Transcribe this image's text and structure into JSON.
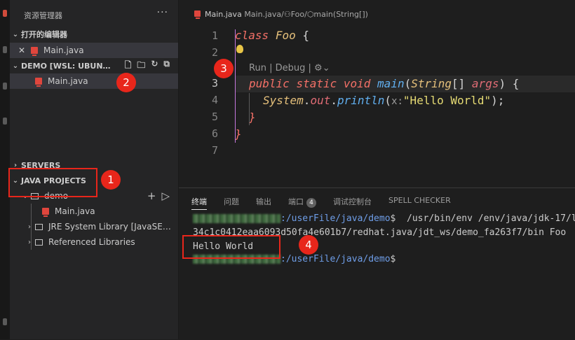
{
  "sidebar": {
    "title": "资源管理器",
    "more": "···",
    "open_editors": {
      "label": "打开的编辑器",
      "file": "Main.java",
      "close": "✕"
    },
    "workspace": {
      "label": "DEMO [WSL: UBUN…",
      "file": "Main.java"
    },
    "servers": {
      "label": "SERVERS"
    },
    "java_projects": {
      "label": "JAVA PROJECTS",
      "project": "demo",
      "file": "Main.java",
      "jre": "JRE System Library [JavaSE…",
      "refs": "Referenced Libraries"
    }
  },
  "editor": {
    "breadcrumb": {
      "file": "Main.java",
      "folder": "Main.java/",
      "cls": "Foo/",
      "method": "main(String[])"
    },
    "line_numbers": [
      "1",
      "2",
      "3",
      "4",
      "5",
      "6",
      "7"
    ],
    "codelens": {
      "run": "Run",
      "sep1": "|",
      "debug": "Debug",
      "sep2": "|"
    },
    "code": {
      "l1_kw": "class",
      "l1_cls": "Foo",
      "l1_brace": "{",
      "l3_public": "public",
      "l3_static": "static",
      "l3_void": "void",
      "l3_fn": "main",
      "l3_open": "(",
      "l3_type": "String",
      "l3_arr": "[]",
      "l3_param": "args",
      "l3_close": ")",
      "l3_brace": "{",
      "l4_sys": "System",
      "l4_dot1": ".",
      "l4_out": "out",
      "l4_dot2": ".",
      "l4_fn": "println",
      "l4_open": "(",
      "l4_hint": "x:",
      "l4_str": "\"Hello World\"",
      "l4_close": ");",
      "l5_brace": "}",
      "l6_brace": "}"
    }
  },
  "panel": {
    "tabs": [
      "终端",
      "问题",
      "输出",
      "端口",
      "调试控制台",
      "SPELL CHECKER"
    ],
    "ports_count": "4",
    "terminal": {
      "line1_path": ":/userFile/java/demo",
      "line1_cmd": "$  /usr/bin/env /env/java/jdk-17/l",
      "line2": "34c1c0412eaa6093d50fa4e601b7/redhat.java/jdt_ws/demo_fa263f7/bin Foo",
      "output": "Hello World",
      "line4_path": ":/userFile/java/demo",
      "line4_prompt": "$"
    }
  },
  "annotations": [
    "1",
    "2",
    "3",
    "4"
  ]
}
